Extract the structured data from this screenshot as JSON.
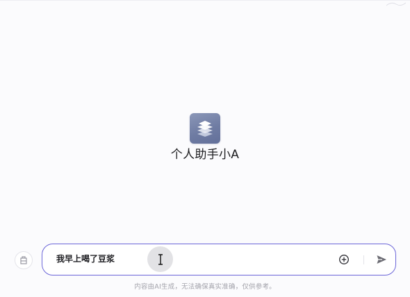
{
  "assistant": {
    "name": "个人助手小A",
    "avatar_icon": "layers-icon",
    "avatar_color": "#6f7ca3"
  },
  "composer": {
    "value": "我早上喝了豆浆",
    "attach_icon": "attachment-icon",
    "plus_icon": "plus-circle-icon",
    "send_icon": "send-icon",
    "border_color": "#6a64d8"
  },
  "footer": {
    "disclaimer": "内容由AI生成，无法确保真实准确，仅供参考。"
  }
}
